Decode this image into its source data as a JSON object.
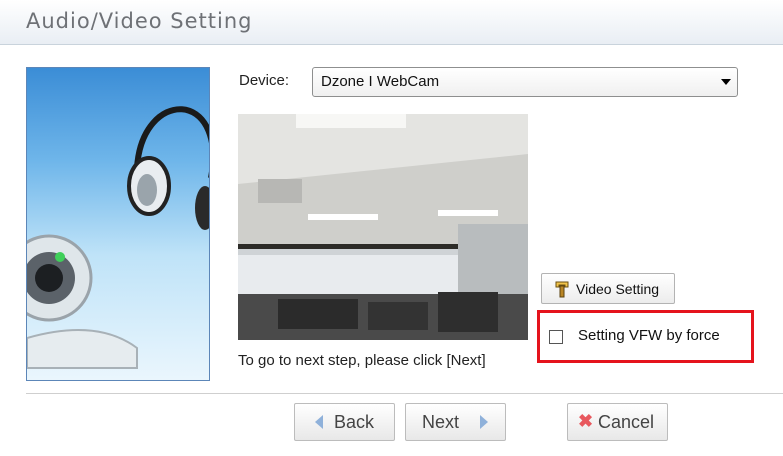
{
  "window": {
    "title": "Audio/Video Setting"
  },
  "device": {
    "label": "Device:",
    "selected": "Dzone I WebCam"
  },
  "preview": {
    "hint": "To go to next step, please click [Next]"
  },
  "video_setting": {
    "label": "Video Setting",
    "icon": "wrench-icon"
  },
  "vfw": {
    "label": "Setting VFW by force",
    "checked": false
  },
  "footer": {
    "back_label": "Back",
    "next_label": "Next",
    "cancel_label": "Cancel"
  },
  "colors": {
    "highlight": "#e5131c",
    "arrow": "#8fb1da",
    "cancel_x": "#e8585e"
  }
}
